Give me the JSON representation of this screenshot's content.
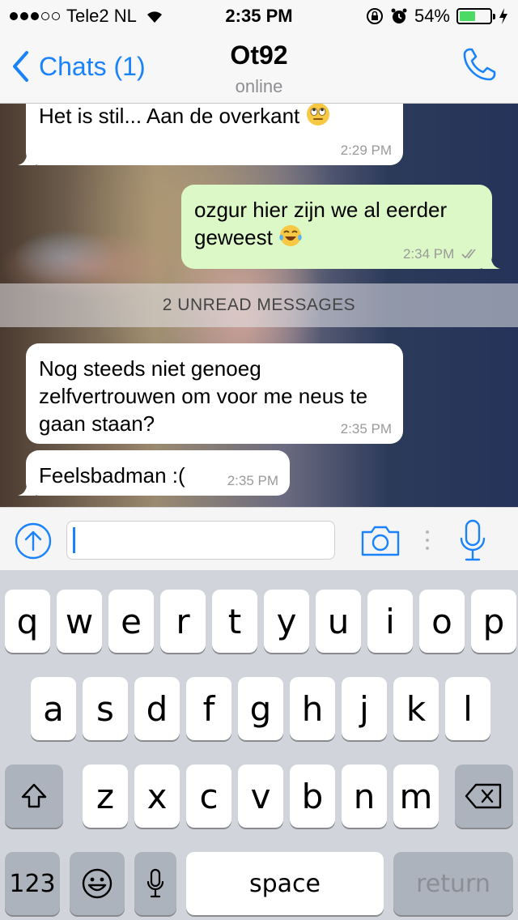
{
  "status_bar": {
    "carrier": "Tele2 NL",
    "time": "2:35 PM",
    "battery": "54%",
    "battery_level": 0.54,
    "signal_bars": 3
  },
  "nav": {
    "back_label": "Chats (1)",
    "title": "Ot92",
    "subtitle": "online",
    "accent": "#1a82fb"
  },
  "messages": [
    {
      "direction": "in",
      "text": "Het is stil... Aan de overkant",
      "emoji": "face-with-rolling-eyes",
      "time": "2:29 PM"
    },
    {
      "direction": "out",
      "text": "ozgur hier zijn we al eerder geweest",
      "emoji": "face-with-tears-of-joy",
      "time": "2:34 PM",
      "read_ticks": "double"
    },
    {
      "direction": "in",
      "text": "Nog steeds niet genoeg zelfvertrouwen om voor me neus te gaan staan?",
      "time": "2:35 PM"
    },
    {
      "direction": "in",
      "text": "Feelsbadman :(",
      "time": "2:35 PM"
    }
  ],
  "unread_separator": "2 UNREAD MESSAGES",
  "input": {
    "value": "",
    "icons": [
      "upload-arrow-icon",
      "camera-icon",
      "microphone-icon"
    ]
  },
  "keyboard": {
    "row1": [
      "q",
      "w",
      "e",
      "r",
      "t",
      "y",
      "u",
      "i",
      "o",
      "p"
    ],
    "row2": [
      "a",
      "s",
      "d",
      "f",
      "g",
      "h",
      "j",
      "k",
      "l"
    ],
    "row3": [
      "z",
      "x",
      "c",
      "v",
      "b",
      "n",
      "m"
    ],
    "numbers_label": "123",
    "space_label": "space",
    "return_label": "return"
  }
}
